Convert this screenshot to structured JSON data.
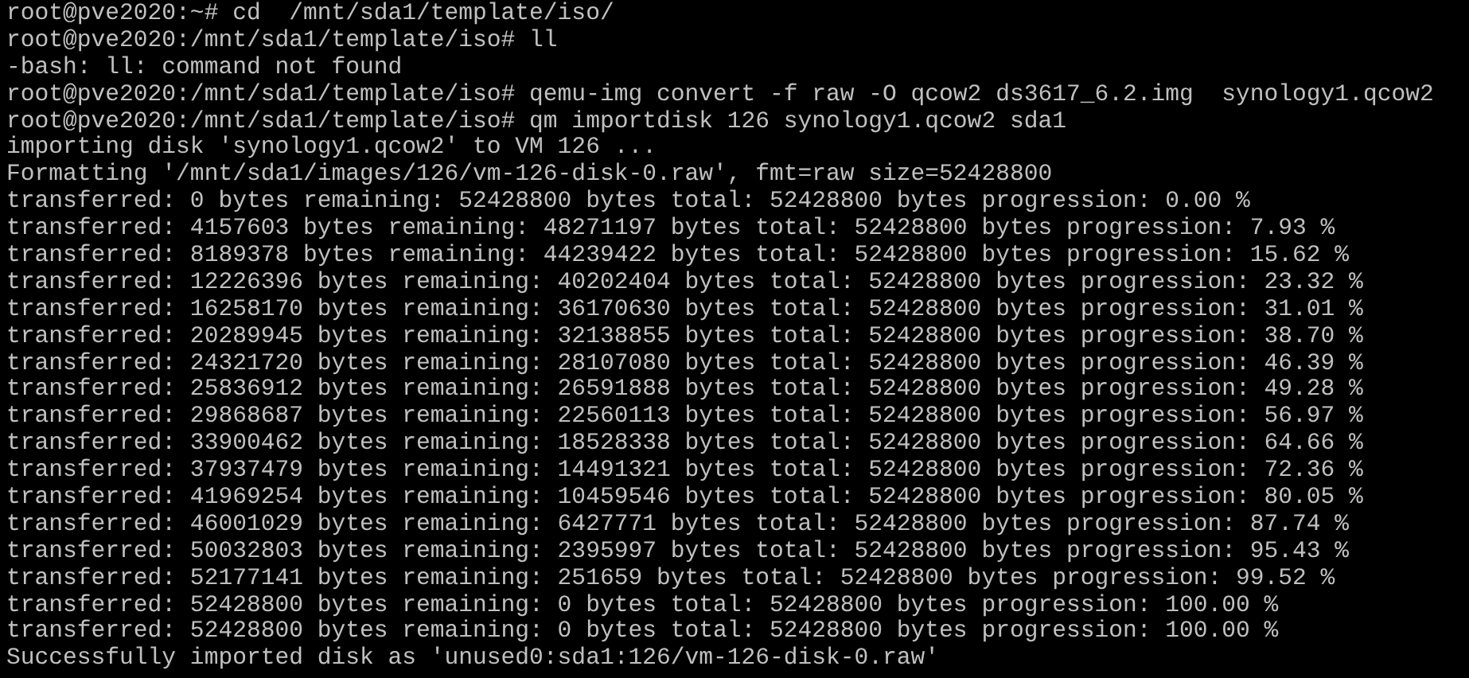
{
  "terminal": {
    "lines": [
      "root@pve2020:~# cd  /mnt/sda1/template/iso/",
      "root@pve2020:/mnt/sda1/template/iso# ll",
      "-bash: ll: command not found",
      "root@pve2020:/mnt/sda1/template/iso# qemu-img convert -f raw -O qcow2 ds3617_6.2.img  synology1.qcow2",
      "root@pve2020:/mnt/sda1/template/iso# qm importdisk 126 synology1.qcow2 sda1",
      "importing disk 'synology1.qcow2' to VM 126 ...",
      "Formatting '/mnt/sda1/images/126/vm-126-disk-0.raw', fmt=raw size=52428800",
      "transferred: 0 bytes remaining: 52428800 bytes total: 52428800 bytes progression: 0.00 %",
      "transferred: 4157603 bytes remaining: 48271197 bytes total: 52428800 bytes progression: 7.93 %",
      "transferred: 8189378 bytes remaining: 44239422 bytes total: 52428800 bytes progression: 15.62 %",
      "transferred: 12226396 bytes remaining: 40202404 bytes total: 52428800 bytes progression: 23.32 %",
      "transferred: 16258170 bytes remaining: 36170630 bytes total: 52428800 bytes progression: 31.01 %",
      "transferred: 20289945 bytes remaining: 32138855 bytes total: 52428800 bytes progression: 38.70 %",
      "transferred: 24321720 bytes remaining: 28107080 bytes total: 52428800 bytes progression: 46.39 %",
      "transferred: 25836912 bytes remaining: 26591888 bytes total: 52428800 bytes progression: 49.28 %",
      "transferred: 29868687 bytes remaining: 22560113 bytes total: 52428800 bytes progression: 56.97 %",
      "transferred: 33900462 bytes remaining: 18528338 bytes total: 52428800 bytes progression: 64.66 %",
      "transferred: 37937479 bytes remaining: 14491321 bytes total: 52428800 bytes progression: 72.36 %",
      "transferred: 41969254 bytes remaining: 10459546 bytes total: 52428800 bytes progression: 80.05 %",
      "transferred: 46001029 bytes remaining: 6427771 bytes total: 52428800 bytes progression: 87.74 %",
      "transferred: 50032803 bytes remaining: 2395997 bytes total: 52428800 bytes progression: 95.43 %",
      "transferred: 52177141 bytes remaining: 251659 bytes total: 52428800 bytes progression: 99.52 %",
      "transferred: 52428800 bytes remaining: 0 bytes total: 52428800 bytes progression: 100.00 %",
      "transferred: 52428800 bytes remaining: 0 bytes total: 52428800 bytes progression: 100.00 %",
      "Successfully imported disk as 'unused0:sda1:126/vm-126-disk-0.raw'"
    ]
  }
}
